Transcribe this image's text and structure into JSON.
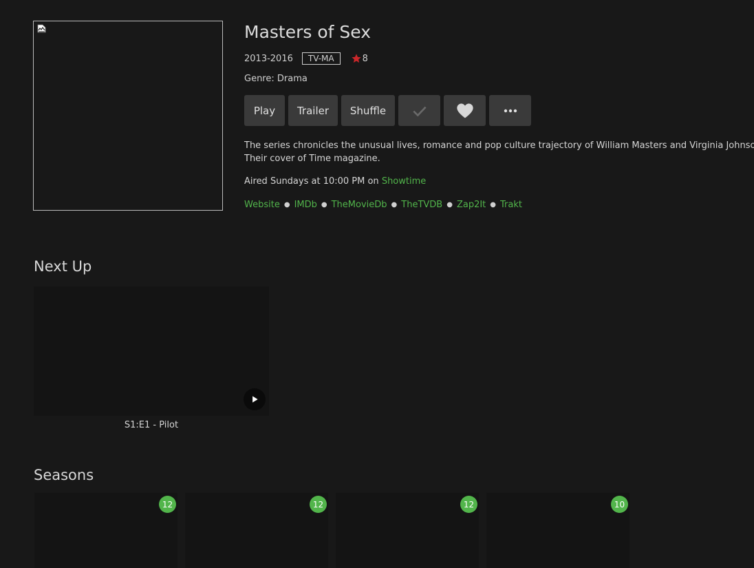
{
  "show": {
    "title": "Masters of Sex",
    "years": "2013-2016",
    "content_rating": "TV-MA",
    "community_rating": "8",
    "genre_line": "Genre: Drama",
    "overview": "The series chronicles the unusual lives, romance and pop culture trajectory of William Masters and Virginia Johnson. Their cover of Time magazine.",
    "aired_prefix": "Aired Sundays at 10:00 PM on",
    "network": "Showtime"
  },
  "buttons": {
    "play": "Play",
    "trailer": "Trailer",
    "shuffle": "Shuffle",
    "watched_icon": "check-icon",
    "favorite_icon": "heart-icon",
    "more_icon": "more-horizontal-icon"
  },
  "external_links": [
    "Website",
    "IMDb",
    "TheMovieDb",
    "TheTVDB",
    "Zap2It",
    "Trakt"
  ],
  "next_up": {
    "heading": "Next Up",
    "episode_label": "S1:E1 - Pilot"
  },
  "seasons": {
    "heading": "Seasons",
    "episode_counts": [
      "12",
      "12",
      "12",
      "10"
    ]
  },
  "colors": {
    "accent": "#52b54b",
    "star": "#cb272a",
    "background": "#181818",
    "button_bg": "#3a3a3a"
  }
}
